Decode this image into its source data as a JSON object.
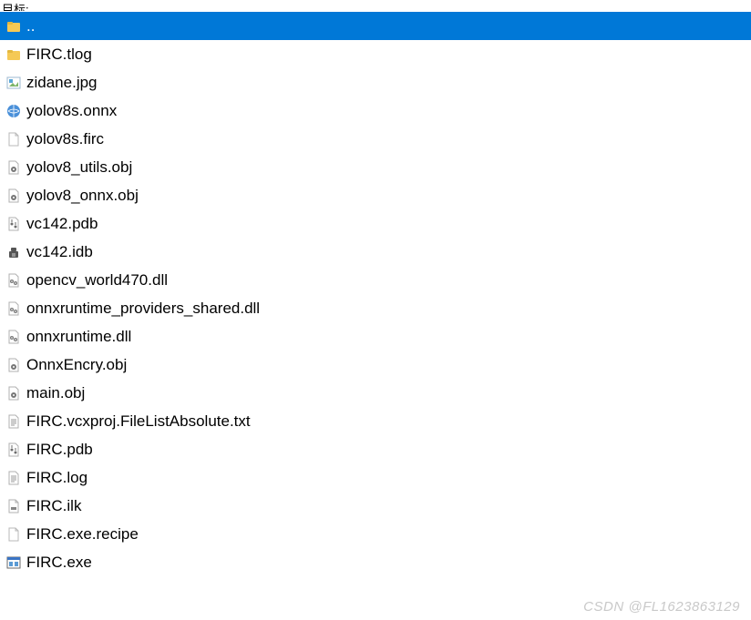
{
  "header": {
    "partial_label": "目标:"
  },
  "selection_color": "#0078d7",
  "files": [
    {
      "name": "..",
      "icon": "folder-up-icon",
      "selected": true
    },
    {
      "name": "FIRC.tlog",
      "icon": "folder-icon",
      "selected": false
    },
    {
      "name": "zidane.jpg",
      "icon": "image-icon",
      "selected": false
    },
    {
      "name": "yolov8s.onnx",
      "icon": "globe-icon",
      "selected": false
    },
    {
      "name": "yolov8s.firc",
      "icon": "blank-file-icon",
      "selected": false
    },
    {
      "name": "yolov8_utils.obj",
      "icon": "obj-file-icon",
      "selected": false
    },
    {
      "name": "yolov8_onnx.obj",
      "icon": "obj-file-icon",
      "selected": false
    },
    {
      "name": "vc142.pdb",
      "icon": "pdb-file-icon",
      "selected": false
    },
    {
      "name": "vc142.idb",
      "icon": "idb-file-icon",
      "selected": false
    },
    {
      "name": "opencv_world470.dll",
      "icon": "dll-file-icon",
      "selected": false
    },
    {
      "name": "onnxruntime_providers_shared.dll",
      "icon": "dll-file-icon",
      "selected": false
    },
    {
      "name": "onnxruntime.dll",
      "icon": "dll-file-icon",
      "selected": false
    },
    {
      "name": "OnnxEncry.obj",
      "icon": "obj-file-icon",
      "selected": false
    },
    {
      "name": "main.obj",
      "icon": "obj-file-icon",
      "selected": false
    },
    {
      "name": "FIRC.vcxproj.FileListAbsolute.txt",
      "icon": "txt-file-icon",
      "selected": false
    },
    {
      "name": "FIRC.pdb",
      "icon": "pdb-file-icon",
      "selected": false
    },
    {
      "name": "FIRC.log",
      "icon": "txt-file-icon",
      "selected": false
    },
    {
      "name": "FIRC.ilk",
      "icon": "ilk-file-icon",
      "selected": false
    },
    {
      "name": "FIRC.exe.recipe",
      "icon": "blank-file-icon",
      "selected": false
    },
    {
      "name": "FIRC.exe",
      "icon": "exe-file-icon",
      "selected": false
    }
  ],
  "watermark": "CSDN @FL1623863129"
}
